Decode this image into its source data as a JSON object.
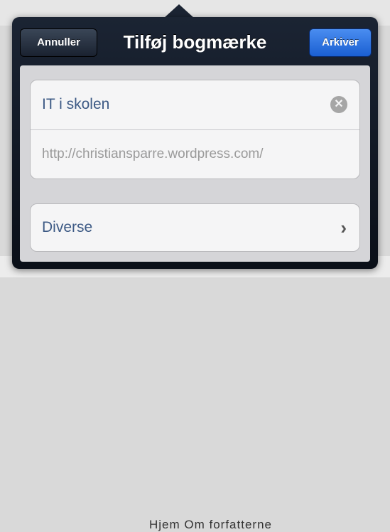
{
  "background": {
    "bottom_text": "Hjem Om forfatterne"
  },
  "popover": {
    "title": "Tilføj bogmærke",
    "cancel_label": "Annuller",
    "save_label": "Arkiver"
  },
  "bookmark": {
    "title_value": "IT i skolen",
    "url_value": "http://christiansparre.wordpress.com/",
    "clear_icon": "clear-icon",
    "folder_label": "Diverse",
    "chevron_icon": "chevron-right-icon"
  },
  "colors": {
    "accent_blue": "#2f74e3",
    "text_blue": "#3d5a85",
    "nav_dark": "#1b2433"
  }
}
